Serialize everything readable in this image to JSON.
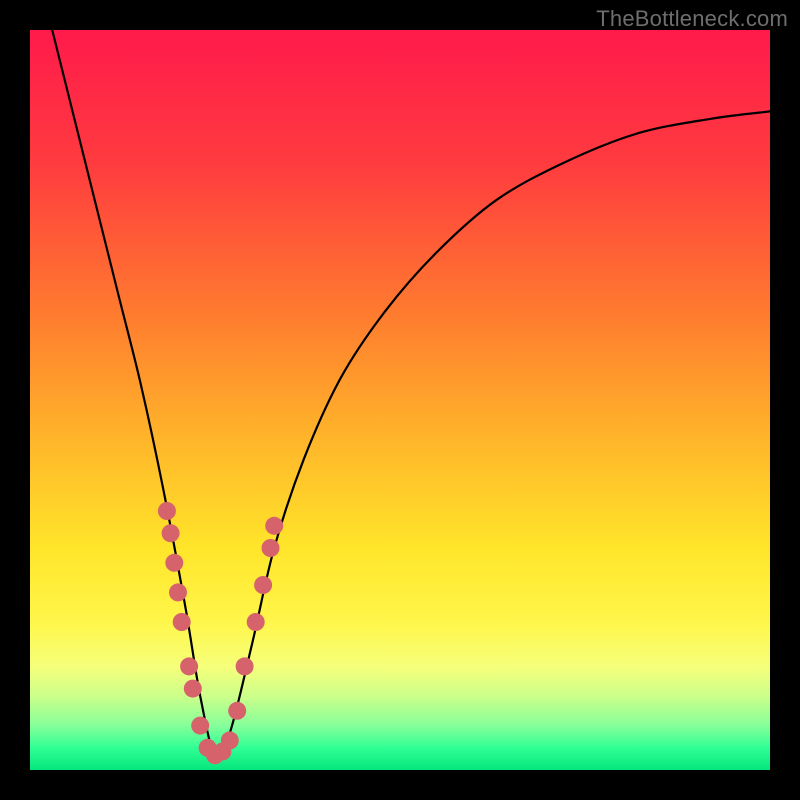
{
  "watermark": "TheBottleneck.com",
  "chart_data": {
    "type": "line",
    "title": "",
    "xlabel": "",
    "ylabel": "",
    "xlim": [
      0,
      100
    ],
    "ylim": [
      0,
      100
    ],
    "gradient_stops": [
      {
        "offset": 0,
        "color": "#ff1a4b"
      },
      {
        "offset": 18,
        "color": "#ff3b3f"
      },
      {
        "offset": 38,
        "color": "#ff7a2f"
      },
      {
        "offset": 55,
        "color": "#ffb42a"
      },
      {
        "offset": 70,
        "color": "#ffe52a"
      },
      {
        "offset": 80,
        "color": "#fff64a"
      },
      {
        "offset": 86,
        "color": "#f6ff7a"
      },
      {
        "offset": 90,
        "color": "#ccff8a"
      },
      {
        "offset": 94,
        "color": "#86ff9a"
      },
      {
        "offset": 97,
        "color": "#30ff94"
      },
      {
        "offset": 100,
        "color": "#05e67e"
      }
    ],
    "series": [
      {
        "name": "bottleneck-curve",
        "x": [
          3,
          6,
          9,
          12,
          15,
          18,
          21,
          23,
          25,
          27,
          30,
          33,
          37,
          42,
          48,
          55,
          63,
          72,
          82,
          92,
          100
        ],
        "y": [
          100,
          88,
          76,
          64,
          52,
          38,
          22,
          10,
          2,
          5,
          17,
          30,
          42,
          53,
          62,
          70,
          77,
          82,
          86,
          88,
          89
        ]
      }
    ],
    "markers": {
      "name": "highlight-dots",
      "color": "#d6636b",
      "radius": 9,
      "points": [
        {
          "x": 18.5,
          "y": 35
        },
        {
          "x": 19,
          "y": 32
        },
        {
          "x": 19.5,
          "y": 28
        },
        {
          "x": 20,
          "y": 24
        },
        {
          "x": 20.5,
          "y": 20
        },
        {
          "x": 21.5,
          "y": 14
        },
        {
          "x": 22,
          "y": 11
        },
        {
          "x": 23,
          "y": 6
        },
        {
          "x": 24,
          "y": 3
        },
        {
          "x": 25,
          "y": 2
        },
        {
          "x": 26,
          "y": 2.5
        },
        {
          "x": 27,
          "y": 4
        },
        {
          "x": 28,
          "y": 8
        },
        {
          "x": 29,
          "y": 14
        },
        {
          "x": 30.5,
          "y": 20
        },
        {
          "x": 31.5,
          "y": 25
        },
        {
          "x": 32.5,
          "y": 30
        },
        {
          "x": 33,
          "y": 33
        }
      ]
    }
  }
}
